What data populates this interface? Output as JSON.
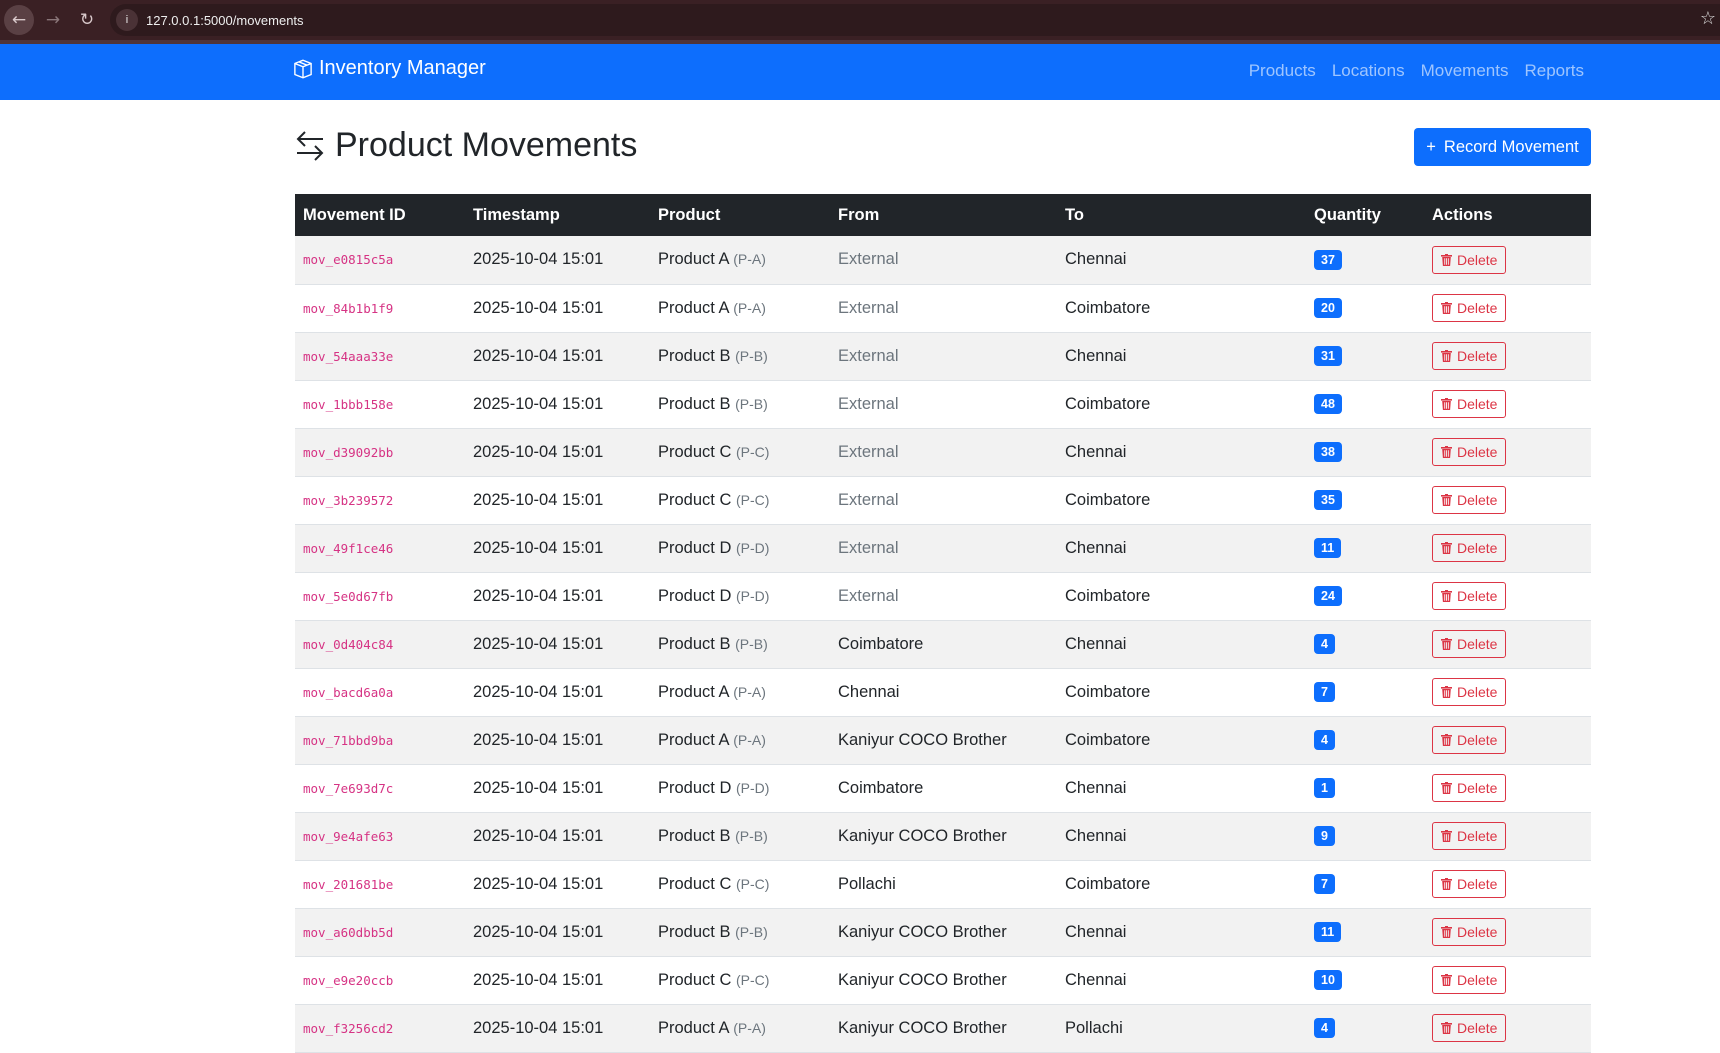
{
  "browser": {
    "url": "127.0.0.1:5000/movements"
  },
  "navbar": {
    "brand": "Inventory Manager",
    "links": [
      "Products",
      "Locations",
      "Movements",
      "Reports"
    ]
  },
  "page": {
    "title": "Product Movements",
    "record_button": "Record Movement"
  },
  "colors": {
    "primary": "#0d6efd",
    "danger": "#dc3545",
    "id": "#d63384",
    "header": "#212529"
  },
  "table": {
    "headers": [
      "Movement ID",
      "Timestamp",
      "Product",
      "From",
      "To",
      "Quantity",
      "Actions"
    ],
    "delete_label": "Delete",
    "rows": [
      [
        "mov_e0815c5a",
        "2025-10-04 15:01",
        "Product A",
        "(P-A)",
        "External",
        "Chennai",
        "37"
      ],
      [
        "mov_84b1b1f9",
        "2025-10-04 15:01",
        "Product A",
        "(P-A)",
        "External",
        "Coimbatore",
        "20"
      ],
      [
        "mov_54aaa33e",
        "2025-10-04 15:01",
        "Product B",
        "(P-B)",
        "External",
        "Chennai",
        "31"
      ],
      [
        "mov_1bbb158e",
        "2025-10-04 15:01",
        "Product B",
        "(P-B)",
        "External",
        "Coimbatore",
        "48"
      ],
      [
        "mov_d39092bb",
        "2025-10-04 15:01",
        "Product C",
        "(P-C)",
        "External",
        "Chennai",
        "38"
      ],
      [
        "mov_3b239572",
        "2025-10-04 15:01",
        "Product C",
        "(P-C)",
        "External",
        "Coimbatore",
        "35"
      ],
      [
        "mov_49f1ce46",
        "2025-10-04 15:01",
        "Product D",
        "(P-D)",
        "External",
        "Chennai",
        "11"
      ],
      [
        "mov_5e0d67fb",
        "2025-10-04 15:01",
        "Product D",
        "(P-D)",
        "External",
        "Coimbatore",
        "24"
      ],
      [
        "mov_0d404c84",
        "2025-10-04 15:01",
        "Product B",
        "(P-B)",
        "Coimbatore",
        "Chennai",
        "4"
      ],
      [
        "mov_bacd6a0a",
        "2025-10-04 15:01",
        "Product A",
        "(P-A)",
        "Chennai",
        "Coimbatore",
        "7"
      ],
      [
        "mov_71bbd9ba",
        "2025-10-04 15:01",
        "Product A",
        "(P-A)",
        "Kaniyur COCO Brother",
        "Coimbatore",
        "4"
      ],
      [
        "mov_7e693d7c",
        "2025-10-04 15:01",
        "Product D",
        "(P-D)",
        "Coimbatore",
        "Chennai",
        "1"
      ],
      [
        "mov_9e4afe63",
        "2025-10-04 15:01",
        "Product B",
        "(P-B)",
        "Kaniyur COCO Brother",
        "Chennai",
        "9"
      ],
      [
        "mov_201681be",
        "2025-10-04 15:01",
        "Product C",
        "(P-C)",
        "Pollachi",
        "Coimbatore",
        "7"
      ],
      [
        "mov_a60dbb5d",
        "2025-10-04 15:01",
        "Product B",
        "(P-B)",
        "Kaniyur COCO Brother",
        "Chennai",
        "11"
      ],
      [
        "mov_e9e20ccb",
        "2025-10-04 15:01",
        "Product C",
        "(P-C)",
        "Kaniyur COCO Brother",
        "Chennai",
        "10"
      ],
      [
        "mov_f3256cd2",
        "2025-10-04 15:01",
        "Product A",
        "(P-A)",
        "Kaniyur COCO Brother",
        "Pollachi",
        "4"
      ]
    ]
  }
}
